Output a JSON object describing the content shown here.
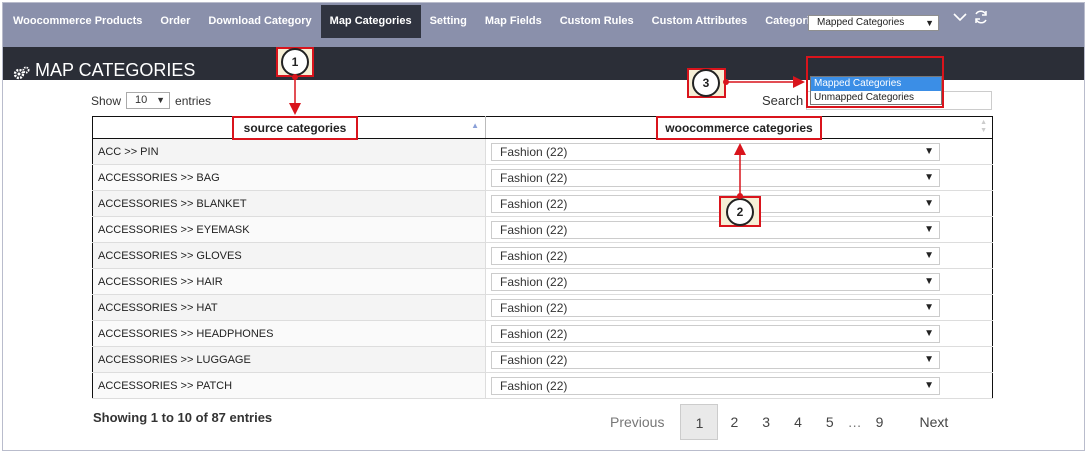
{
  "nav": {
    "items": [
      {
        "label": "Woocommerce Products",
        "active": false
      },
      {
        "label": "Order",
        "active": false
      },
      {
        "label": "Download Category",
        "active": false
      },
      {
        "label": "Map Categories",
        "active": true
      },
      {
        "label": "Setting",
        "active": false
      },
      {
        "label": "Map Fields",
        "active": false
      },
      {
        "label": "Custom Rules",
        "active": false
      },
      {
        "label": "Custom Attributes",
        "active": false
      },
      {
        "label": "Categories In Use",
        "active": false
      }
    ]
  },
  "header": {
    "title": "MAP CATEGORIES",
    "filter_value": "Mapped Categories",
    "filter_options": [
      "Mapped Categories",
      "Unmapped Categories"
    ],
    "collapse_icon": "chevron-down-icon",
    "refresh_icon": "refresh-icon"
  },
  "controls": {
    "show_label": "Show",
    "length_value": "10",
    "entries_label": "entries",
    "search_label": "Search"
  },
  "table": {
    "columns": [
      "source categories",
      "woocommerce categories"
    ],
    "rows": [
      {
        "source": "ACC >> PIN",
        "target": "Fashion (22)"
      },
      {
        "source": "ACCESSORIES >> BAG",
        "target": "Fashion (22)"
      },
      {
        "source": "ACCESSORIES >> BLANKET",
        "target": "Fashion (22)"
      },
      {
        "source": "ACCESSORIES >> EYEMASK",
        "target": "Fashion (22)"
      },
      {
        "source": "ACCESSORIES >> GLOVES",
        "target": "Fashion (22)"
      },
      {
        "source": "ACCESSORIES >> HAIR",
        "target": "Fashion (22)"
      },
      {
        "source": "ACCESSORIES >> HAT",
        "target": "Fashion (22)"
      },
      {
        "source": "ACCESSORIES >> HEADPHONES",
        "target": "Fashion (22)"
      },
      {
        "source": "ACCESSORIES >> LUGGAGE",
        "target": "Fashion (22)"
      },
      {
        "source": "ACCESSORIES >> PATCH",
        "target": "Fashion (22)"
      }
    ]
  },
  "footer": {
    "info": "Showing 1 to 10 of 87 entries",
    "previous": "Previous",
    "pages": [
      "1",
      "2",
      "3",
      "4",
      "5"
    ],
    "ellipsis": "…",
    "last_page": "9",
    "next": "Next",
    "current_page": "1"
  },
  "annotations": {
    "markers": [
      "1",
      "2",
      "3"
    ],
    "accent_color": "#d9141c"
  }
}
